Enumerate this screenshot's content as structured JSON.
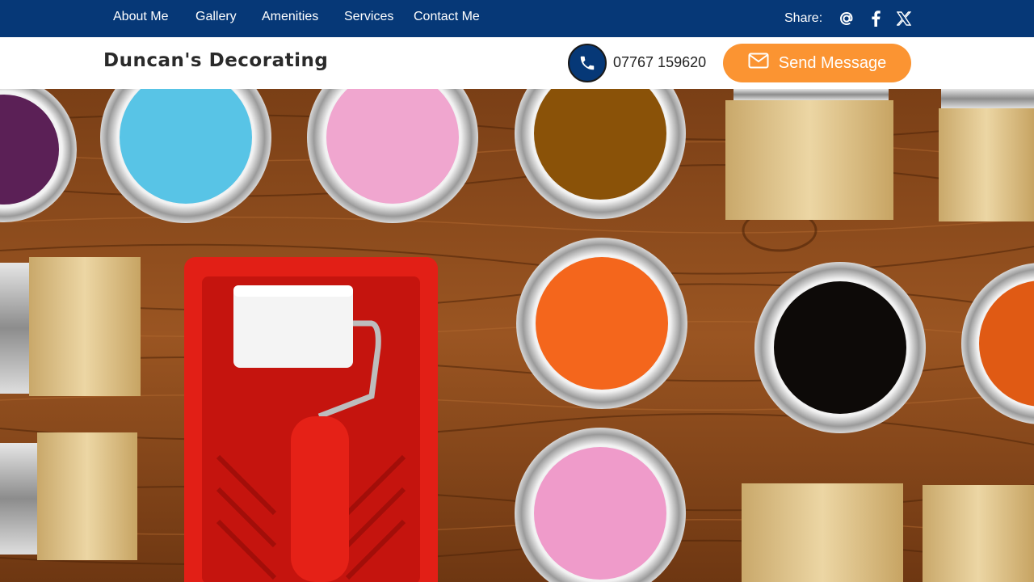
{
  "nav": {
    "items": [
      {
        "label": "About Me"
      },
      {
        "label": "Gallery"
      },
      {
        "label": "Amenities"
      },
      {
        "label": "Services"
      },
      {
        "label": "Contact Me"
      }
    ],
    "share_label": "Share:",
    "share_icons": [
      "at-sign-icon",
      "facebook-icon",
      "x-twitter-icon"
    ]
  },
  "header": {
    "brand": "Duncan's Decorating",
    "phone": "07767 159620",
    "send_label": "Send Message"
  },
  "colors": {
    "nav_bg": "#063877",
    "accent": "#fb9432",
    "wood": "#8a4a1c"
  },
  "hero": {
    "image": "paint-cans-brushes-roller-on-wood"
  }
}
